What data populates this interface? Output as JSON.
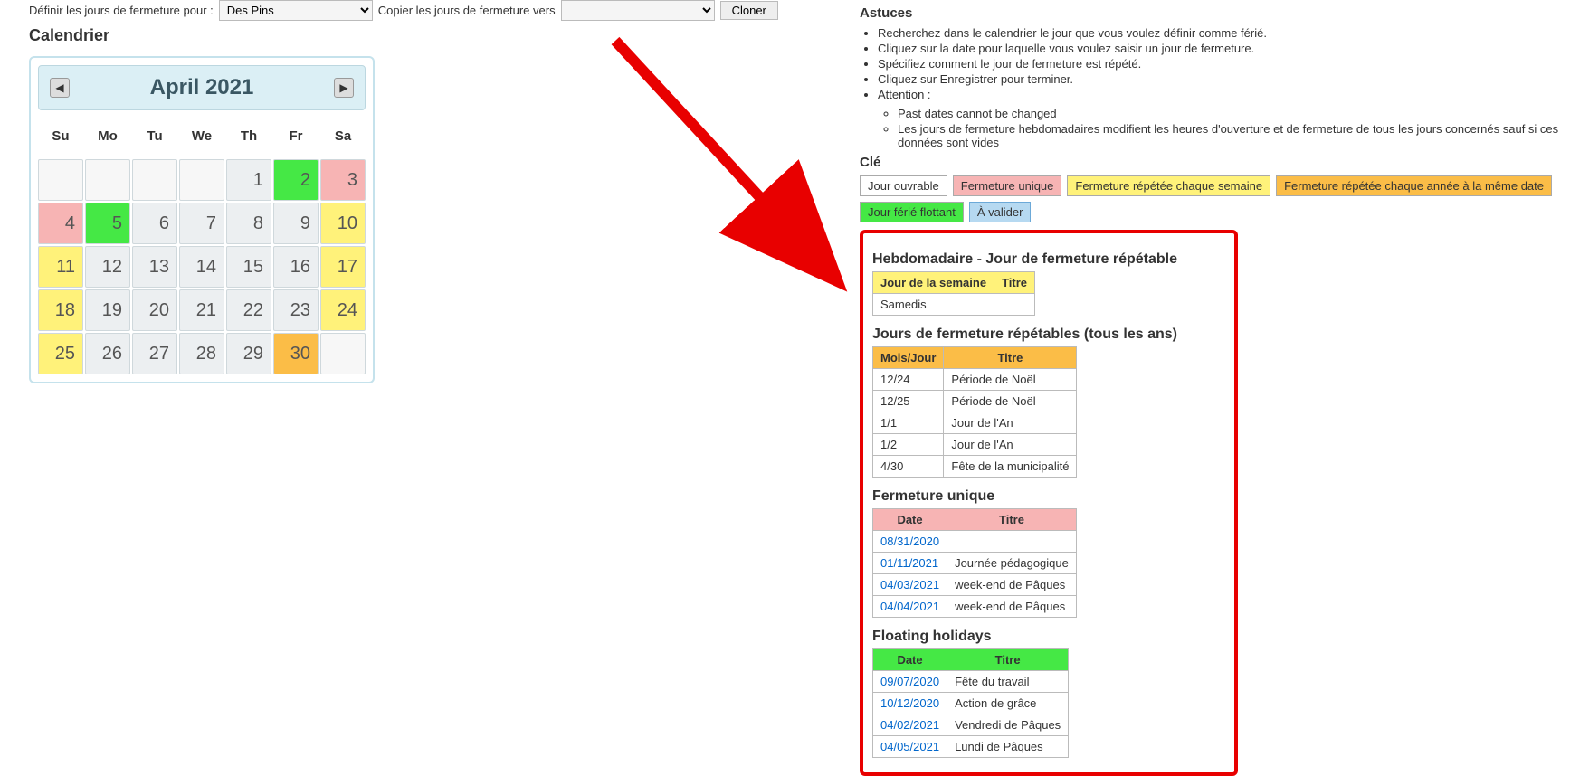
{
  "top": {
    "define_label": "Définir les jours de fermeture pour :",
    "branch_selected": "Des Pins",
    "copy_label": "Copier les jours de fermeture vers",
    "copy_target_selected": "",
    "clone_btn": "Cloner"
  },
  "calendar": {
    "heading": "Calendrier",
    "title": "April 2021",
    "dow": [
      "Su",
      "Mo",
      "Tu",
      "We",
      "Th",
      "Fr",
      "Sa"
    ],
    "cells": [
      {
        "n": "",
        "cls": "empty"
      },
      {
        "n": "",
        "cls": "empty"
      },
      {
        "n": "",
        "cls": "empty"
      },
      {
        "n": "",
        "cls": "empty"
      },
      {
        "n": "1"
      },
      {
        "n": "2",
        "cls": "c-green"
      },
      {
        "n": "3",
        "cls": "c-pink"
      },
      {
        "n": "4",
        "cls": "c-pink"
      },
      {
        "n": "5",
        "cls": "c-green"
      },
      {
        "n": "6"
      },
      {
        "n": "7"
      },
      {
        "n": "8"
      },
      {
        "n": "9"
      },
      {
        "n": "10",
        "cls": "c-yellow"
      },
      {
        "n": "11",
        "cls": "c-yellow"
      },
      {
        "n": "12"
      },
      {
        "n": "13"
      },
      {
        "n": "14"
      },
      {
        "n": "15"
      },
      {
        "n": "16"
      },
      {
        "n": "17",
        "cls": "c-yellow"
      },
      {
        "n": "18",
        "cls": "c-yellow"
      },
      {
        "n": "19"
      },
      {
        "n": "20"
      },
      {
        "n": "21"
      },
      {
        "n": "22"
      },
      {
        "n": "23"
      },
      {
        "n": "24",
        "cls": "c-yellow"
      },
      {
        "n": "25",
        "cls": "c-yellow"
      },
      {
        "n": "26"
      },
      {
        "n": "27"
      },
      {
        "n": "28"
      },
      {
        "n": "29"
      },
      {
        "n": "30",
        "cls": "c-orange"
      },
      {
        "n": "",
        "cls": "empty"
      }
    ]
  },
  "hints": {
    "heading": "Astuces",
    "items": [
      "Recherchez dans le calendrier le jour que vous voulez définir comme férié.",
      "Cliquez sur la date pour laquelle vous voulez saisir un jour de fermeture.",
      "Spécifiez comment le jour de fermeture est répété.",
      "Cliquez sur Enregistrer pour terminer.",
      "Attention :"
    ],
    "sub_items": [
      "Past dates cannot be changed",
      "Les jours de fermeture hebdomadaires modifient les heures d'ouverture et de fermeture de tous les jours concernés sauf si ces données sont vides"
    ]
  },
  "key": {
    "heading": "Clé",
    "chips": [
      {
        "label": "Jour ouvrable",
        "cls": "chip-white"
      },
      {
        "label": "Fermeture unique",
        "cls": "chip-pink"
      },
      {
        "label": "Fermeture répétée chaque semaine",
        "cls": "chip-yellow"
      },
      {
        "label": "Fermeture répétée chaque année à la même date",
        "cls": "chip-orange"
      },
      {
        "label": "Jour férié flottant",
        "cls": "chip-green"
      },
      {
        "label": "À valider",
        "cls": "chip-blue"
      }
    ]
  },
  "weekly": {
    "heading": "Hebdomadaire - Jour de fermeture répétable",
    "cols": [
      "Jour de la semaine",
      "Titre"
    ],
    "rows": [
      [
        "Samedis",
        ""
      ]
    ]
  },
  "yearly": {
    "heading": "Jours de fermeture répétables (tous les ans)",
    "cols": [
      "Mois/Jour",
      "Titre"
    ],
    "rows": [
      [
        "12/24",
        "Période de Noël"
      ],
      [
        "12/25",
        "Période de Noël"
      ],
      [
        "1/1",
        "Jour de l'An"
      ],
      [
        "1/2",
        "Jour de l'An"
      ],
      [
        "4/30",
        "Fête de la municipalité"
      ]
    ]
  },
  "unique": {
    "heading": "Fermeture unique",
    "cols": [
      "Date",
      "Titre"
    ],
    "rows": [
      [
        "08/31/2020",
        ""
      ],
      [
        "01/11/2021",
        "Journée pédagogique"
      ],
      [
        "04/03/2021",
        "week-end de Pâques"
      ],
      [
        "04/04/2021",
        "week-end de Pâques"
      ]
    ]
  },
  "floating": {
    "heading": "Floating holidays",
    "cols": [
      "Date",
      "Titre"
    ],
    "rows": [
      [
        "09/07/2020",
        "Fête du travail"
      ],
      [
        "10/12/2020",
        "Action de grâce"
      ],
      [
        "04/02/2021",
        "Vendredi de Pâques"
      ],
      [
        "04/05/2021",
        "Lundi de Pâques"
      ]
    ]
  }
}
